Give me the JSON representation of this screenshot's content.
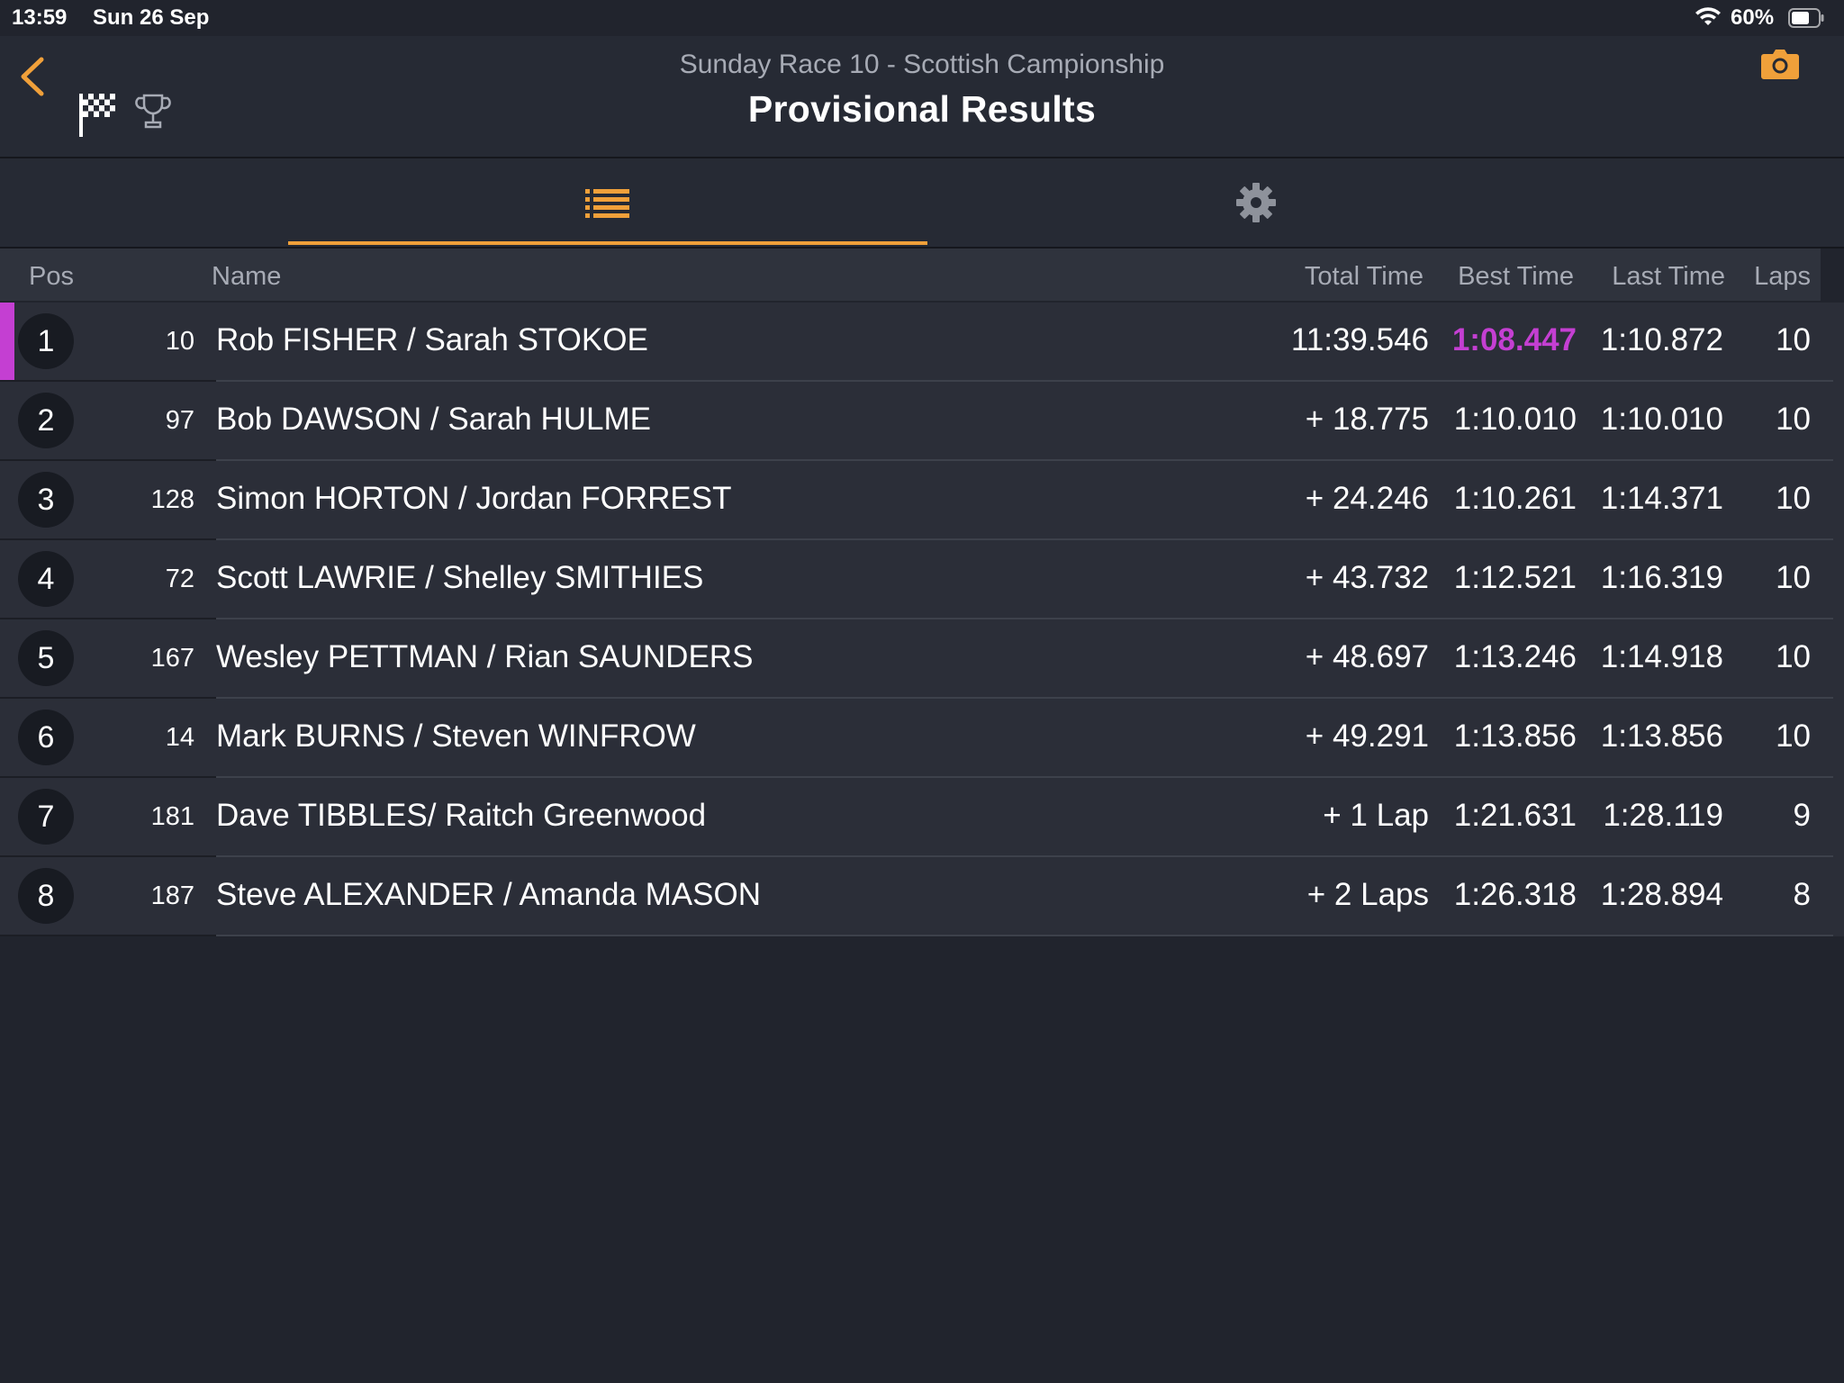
{
  "status_bar": {
    "time": "13:59",
    "date": "Sun 26 Sep",
    "battery": "60%"
  },
  "header": {
    "subtitle": "Sunday Race 10 - Scottish Campionship",
    "title": "Provisional Results"
  },
  "tabs": [
    {
      "icon": "list-icon",
      "active": true
    },
    {
      "icon": "gear-icon",
      "active": false
    }
  ],
  "columns": {
    "pos": "Pos",
    "name": "Name",
    "total": "Total Time",
    "best": "Best Time",
    "last": "Last Time",
    "laps": "Laps"
  },
  "colors": {
    "accent": "#f0a03a",
    "fastest": "#c43fd2",
    "background": "#21242d"
  },
  "rows": [
    {
      "pos": "1",
      "num": "10",
      "name": "Rob FISHER / Sarah STOKOE",
      "total": "11:39.546",
      "best": "1:08.447",
      "last": "1:10.872",
      "laps": "10",
      "fastest": true
    },
    {
      "pos": "2",
      "num": "97",
      "name": "Bob DAWSON / Sarah HULME",
      "total": "+ 18.775",
      "best": "1:10.010",
      "last": "1:10.010",
      "laps": "10"
    },
    {
      "pos": "3",
      "num": "128",
      "name": "Simon HORTON / Jordan FORREST",
      "total": "+ 24.246",
      "best": "1:10.261",
      "last": "1:14.371",
      "laps": "10"
    },
    {
      "pos": "4",
      "num": "72",
      "name": "Scott LAWRIE / Shelley SMITHIES",
      "total": "+ 43.732",
      "best": "1:12.521",
      "last": "1:16.319",
      "laps": "10"
    },
    {
      "pos": "5",
      "num": "167",
      "name": "Wesley PETTMAN / Rian SAUNDERS",
      "total": "+ 48.697",
      "best": "1:13.246",
      "last": "1:14.918",
      "laps": "10"
    },
    {
      "pos": "6",
      "num": "14",
      "name": "Mark BURNS / Steven WINFROW",
      "total": "+ 49.291",
      "best": "1:13.856",
      "last": "1:13.856",
      "laps": "10"
    },
    {
      "pos": "7",
      "num": "181",
      "name": "Dave TIBBLES/ Raitch Greenwood",
      "total": "+ 1 Lap",
      "best": "1:21.631",
      "last": "1:28.119",
      "laps": "9"
    },
    {
      "pos": "8",
      "num": "187",
      "name": "Steve ALEXANDER / Amanda MASON",
      "total": "+ 2 Laps",
      "best": "1:26.318",
      "last": "1:28.894",
      "laps": "8"
    }
  ]
}
